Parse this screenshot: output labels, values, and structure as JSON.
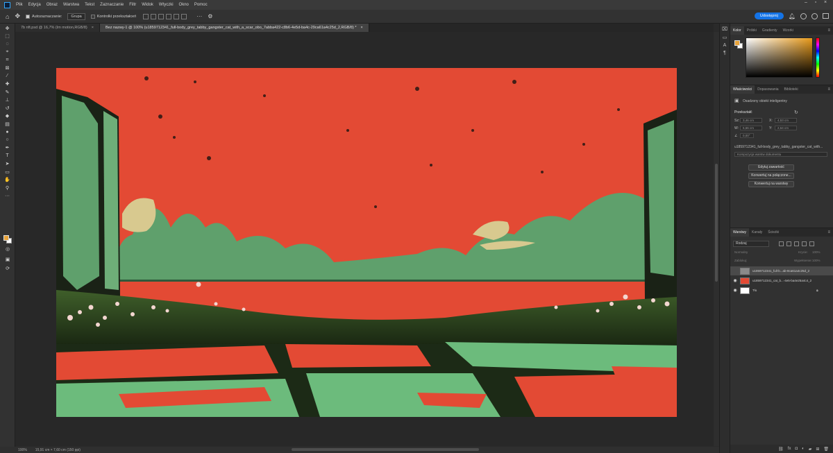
{
  "menu": [
    "Plik",
    "Edycja",
    "Obraz",
    "Warstwa",
    "Tekst",
    "Zaznaczanie",
    "Filtr",
    "Widok",
    "Wtyczki",
    "Okno",
    "Pomoc"
  ],
  "options": {
    "auto_select_label": "Autozaznaczanie:",
    "auto_select_value": "Grupa",
    "transform_label": "Kontrolki przekształceń",
    "more": "···",
    "share_label": "Udostępnij"
  },
  "tabs": [
    {
      "label": "7b nft.psd @ 16,7% (Im motion,RGB/8)",
      "close": "×"
    },
    {
      "label": "Bez nazwy-1 @ 100% (u1859712341_full-body_grey_tabby_gangster_cat_with_a_scar_obo_7abba422-c8b6-4e5d-ba4c-29ca61a4c25d_2,RGB/8) *",
      "close": "×"
    }
  ],
  "status": {
    "zoom": "100%",
    "doc_size": "15,91 cm × 7,60 cm (150 ppi)"
  },
  "color_panel": {
    "tabs": [
      "Kolor",
      "Próbki",
      "Gradienty",
      "Wzorki"
    ]
  },
  "properties": {
    "tabs": [
      "Właściwości",
      "Dopasowania",
      "Biblioteki"
    ],
    "object_type": "Osadzony obiekt inteligentny",
    "transform_title": "Przekształć",
    "w_label": "Sz:",
    "w_value": "3,46 cm",
    "x_label": "X:",
    "x_value": "4,53 cm",
    "h_label": "W:",
    "h_value": "6,66 cm",
    "y_label": "Y:",
    "y_value": "2,64 cm",
    "angle": "0,00°",
    "filename": "u1859712341_full-body_grey_tabby_gangster_cat_with...",
    "comp_placeholder": "Kompozycja warstw dokumentu",
    "buttons": [
      "Edytuj zawartość",
      "Konwertuj na połączone...",
      "Konwertuj na warstwy"
    ]
  },
  "layers": {
    "tabs": [
      "Warstwy",
      "Kanały",
      "Ścieżki"
    ],
    "search": "Rodzaj",
    "blend": "Normalny",
    "opacity_label": "Krycie:",
    "opacity_value": "100%",
    "lock_label": "Zablokuj:",
    "fill_label": "Wypełnienie:",
    "fill_value": "100%",
    "items": [
      {
        "name": "u1859712341_full-b...ab-8ca61a4c25d_2",
        "visible": false,
        "selected": true
      },
      {
        "name": "u1859712341_cat_b...-4e5-ba4e25a4c4_2",
        "visible": true,
        "selected": false
      },
      {
        "name": "Tło",
        "visible": true,
        "selected": false
      }
    ]
  },
  "icons": {
    "home": "home-icon",
    "move": "move-icon",
    "settings": "gear-icon",
    "search": "search-icon",
    "bell": "bell-icon",
    "help": "help-icon"
  }
}
